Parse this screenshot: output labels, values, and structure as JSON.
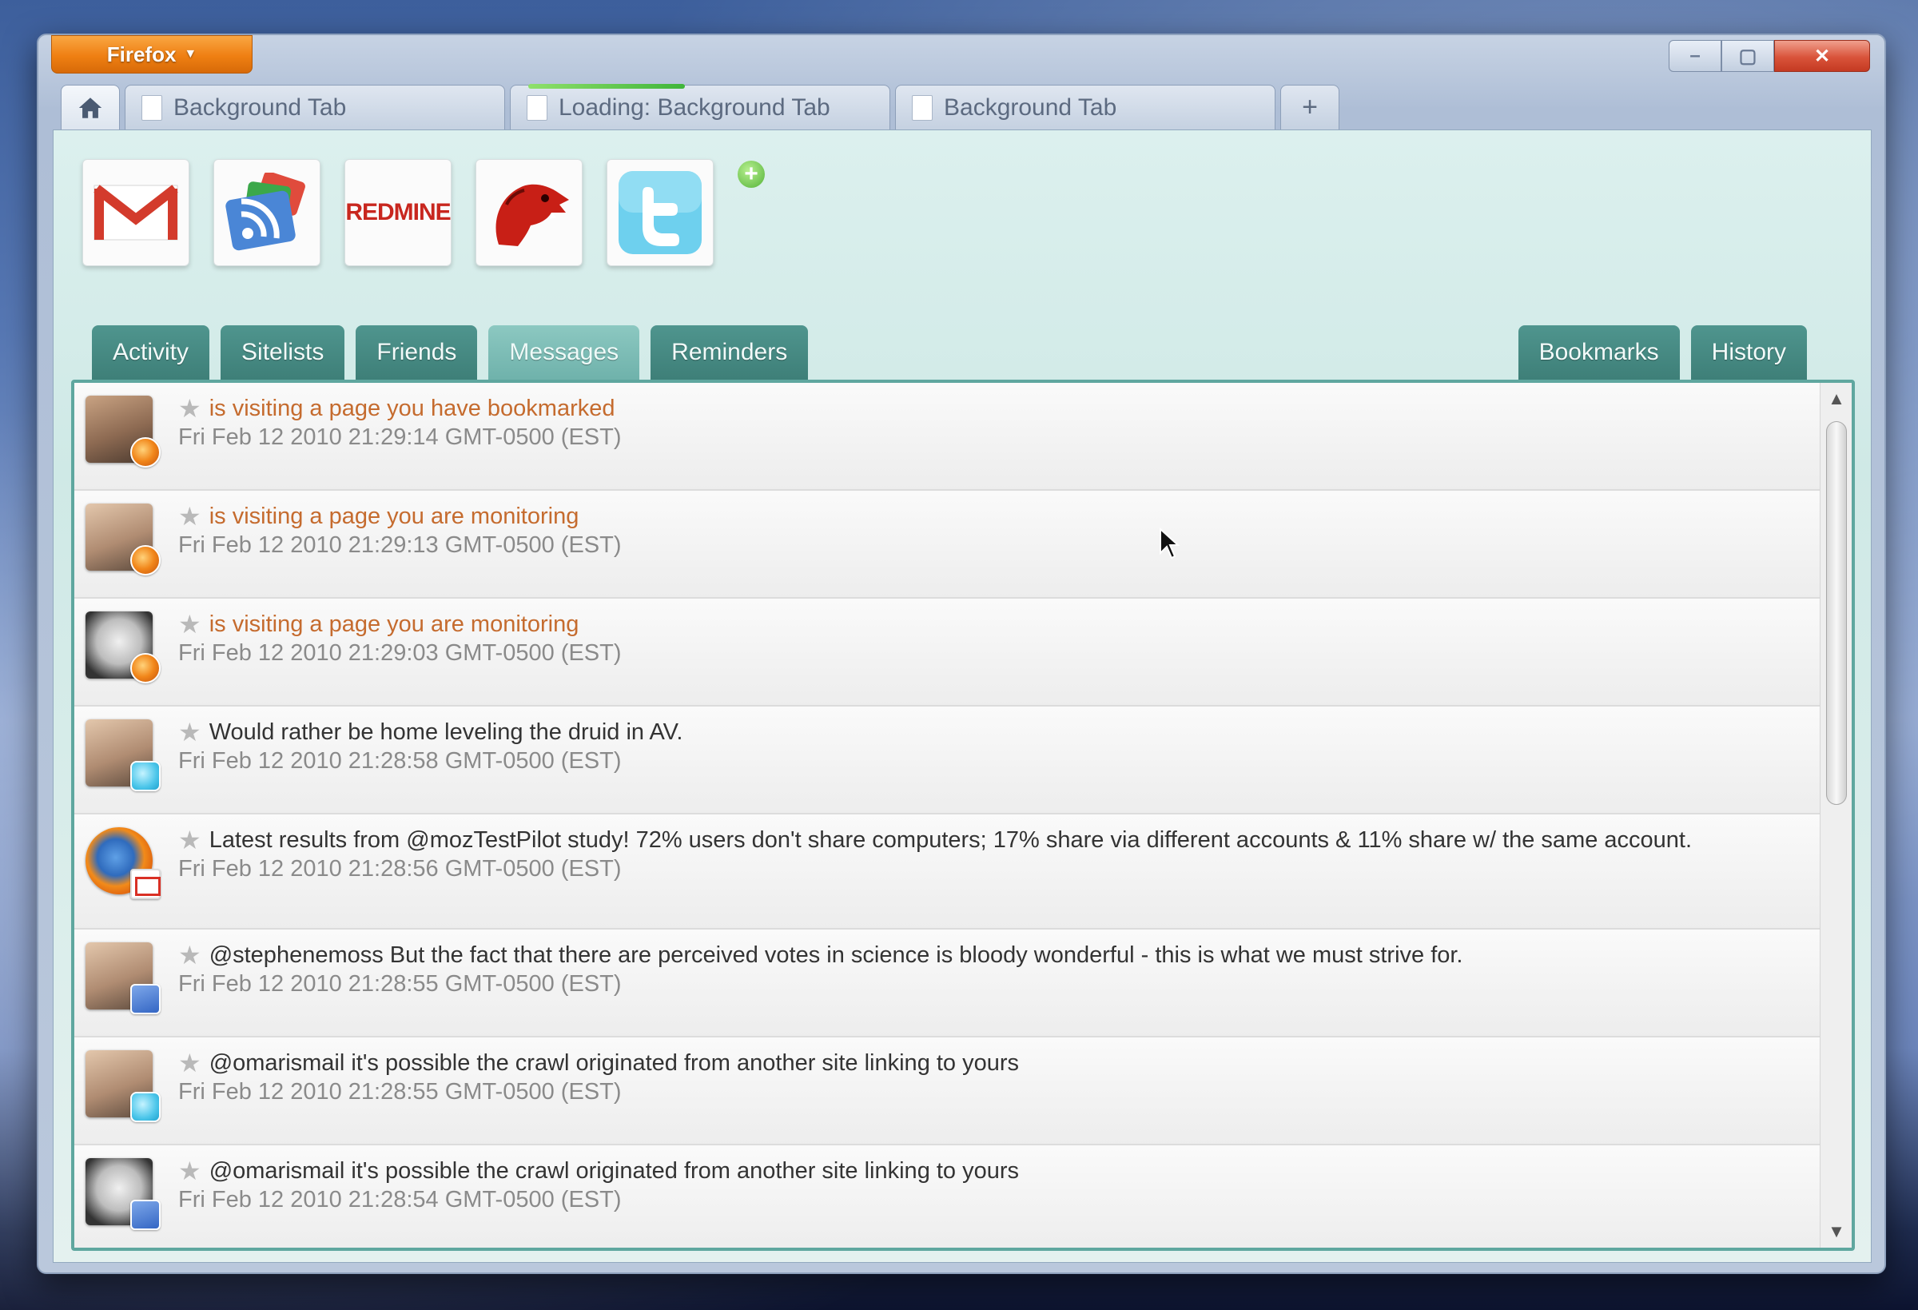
{
  "browser": {
    "menu_label": "Firefox",
    "controls": {
      "minimize": "–",
      "maximize": "▢",
      "close": "✕"
    }
  },
  "tabs": [
    {
      "label": "Background Tab",
      "loading": false
    },
    {
      "label": "Loading: Background Tab",
      "loading": true
    },
    {
      "label": "Background Tab",
      "loading": false
    }
  ],
  "new_tab_label": "+",
  "apps": [
    {
      "name": "gmail",
      "icon": "gmail-icon"
    },
    {
      "name": "google-reader",
      "icon": "rss-icon"
    },
    {
      "name": "redmine",
      "icon": "redmine-logo",
      "text": "REDMINE"
    },
    {
      "name": "mozilla",
      "icon": "mozilla-dino-icon"
    },
    {
      "name": "twitter",
      "icon": "twitter-icon"
    }
  ],
  "add_app_label": "+",
  "nav_left": [
    "Activity",
    "Sitelists",
    "Friends",
    "Messages",
    "Reminders"
  ],
  "nav_right": [
    "Bookmarks",
    "History"
  ],
  "active_tab": "Messages",
  "colors": {
    "accent": "#4f958e",
    "activity_text": "#c56b2e",
    "timestamp": "#8a8a8a"
  },
  "feed": [
    {
      "text": "is visiting a page you have bookmarked",
      "time": "Fri Feb 12 2010 21:29:14 GMT-0500 (EST)",
      "kind": "activity",
      "source": "firefox"
    },
    {
      "text": "is visiting a page you are monitoring",
      "time": "Fri Feb 12 2010 21:29:13 GMT-0500 (EST)",
      "kind": "activity",
      "source": "firefox"
    },
    {
      "text": "is visiting a page you are monitoring",
      "time": "Fri Feb 12 2010 21:29:03 GMT-0500 (EST)",
      "kind": "activity",
      "source": "firefox"
    },
    {
      "text": "Would rather be home leveling the druid in AV.",
      "time": "Fri Feb 12 2010 21:28:58 GMT-0500 (EST)",
      "kind": "message",
      "source": "twitter"
    },
    {
      "text": "Latest results from @mozTestPilot study! 72% users don't share computers; 17% share via different accounts & 11% share w/ the same account.",
      "time": "Fri Feb 12 2010 21:28:56 GMT-0500 (EST)",
      "kind": "message",
      "source": "gmail"
    },
    {
      "text": "@stephenemoss But the fact that there are perceived votes in science is bloody wonderful - this is what we must strive for.",
      "time": "Fri Feb 12 2010 21:28:55 GMT-0500 (EST)",
      "kind": "message",
      "source": "reader"
    },
    {
      "text": "@omarismail it's possible the crawl originated from another site linking to yours",
      "time": "Fri Feb 12 2010 21:28:55 GMT-0500 (EST)",
      "kind": "message",
      "source": "twitter"
    },
    {
      "text": "@omarismail it's possible the crawl originated from another site linking to yours",
      "time": "Fri Feb 12 2010 21:28:54 GMT-0500 (EST)",
      "kind": "message",
      "source": "reader"
    }
  ]
}
